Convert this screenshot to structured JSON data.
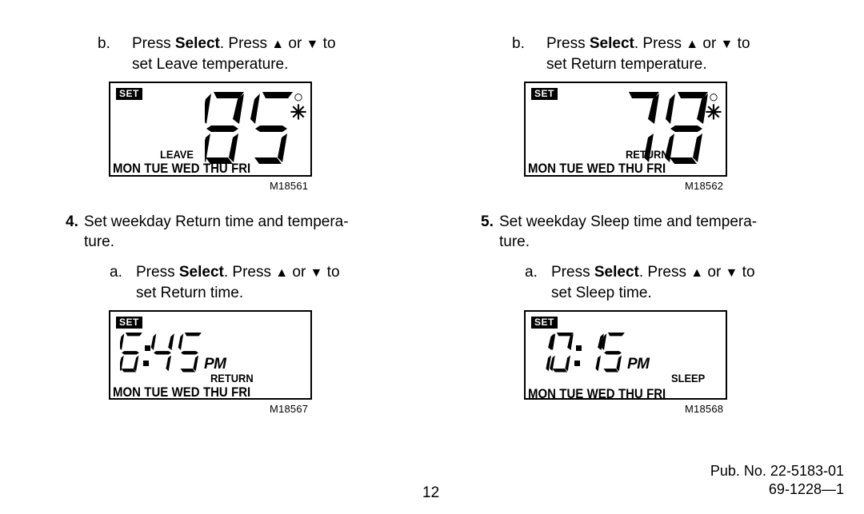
{
  "document": {
    "page_number": "12",
    "pub_line_1": "Pub. No. 22-5183-01",
    "pub_line_2": "69-1228—1"
  },
  "left_column": {
    "sub_step_b": {
      "letter": "b.",
      "text_before_bold": "Press ",
      "bold_word": "Select",
      "text_middle": ". Press ",
      "up_arrow": "▲",
      "or_word": " or ",
      "down_arrow": "▼",
      "text_after": " to",
      "line2": "set Leave temperature."
    },
    "lcd_leave": {
      "set_badge": "SET",
      "value": "85",
      "degree_symbol": "○",
      "snowflake_symbol": "✳",
      "mode_label": "LEAVE",
      "days": [
        "MON",
        "TUE",
        "WED",
        "THU",
        "FRI"
      ],
      "figure_id": "M18561"
    },
    "step_4": {
      "number": "4.",
      "line1": "Set weekday Return time and tempera-",
      "line2": "ture."
    },
    "sub_step_a": {
      "letter": "a.",
      "text_before_bold": "Press ",
      "bold_word": "Select",
      "text_middle": ". Press ",
      "up_arrow": "▲",
      "or_word": " or ",
      "down_arrow": "▼",
      "text_after": " to",
      "line2": "set Return time."
    },
    "lcd_return_time": {
      "set_badge": "SET",
      "value": "6:45",
      "meridiem": "PM",
      "mode_label": "RETURN",
      "days": [
        "MON",
        "TUE",
        "WED",
        "THU",
        "FRI"
      ],
      "figure_id": "M18567"
    }
  },
  "right_column": {
    "sub_step_b": {
      "letter": "b.",
      "text_before_bold": "Press ",
      "bold_word": "Select",
      "text_middle": ". Press ",
      "up_arrow": "▲",
      "or_word": " or ",
      "down_arrow": "▼",
      "text_after": " to",
      "line2": "set Return temperature."
    },
    "lcd_return_temp": {
      "set_badge": "SET",
      "value": "78",
      "degree_symbol": "○",
      "snowflake_symbol": "✳",
      "mode_label": "RETURN",
      "days": [
        "MON",
        "TUE",
        "WED",
        "THU",
        "FRI"
      ],
      "figure_id": "M18562"
    },
    "step_5": {
      "number": "5.",
      "line1": "Set weekday Sleep time and tempera-",
      "line2": "ture."
    },
    "sub_step_a": {
      "letter": "a.",
      "text_before_bold": "Press ",
      "bold_word": "Select",
      "text_middle": ". Press ",
      "up_arrow": "▲",
      "or_word": " or ",
      "down_arrow": "▼",
      "text_after": " to",
      "line2": "set Sleep time."
    },
    "lcd_sleep_time": {
      "set_badge": "SET",
      "value": "10:15",
      "meridiem": "PM",
      "mode_label": "SLEEP",
      "days": [
        "MON",
        "TUE",
        "WED",
        "THU",
        "FRI"
      ],
      "figure_id": "M18568"
    }
  },
  "colors": {
    "ink": "#000000",
    "paper": "#ffffff"
  }
}
